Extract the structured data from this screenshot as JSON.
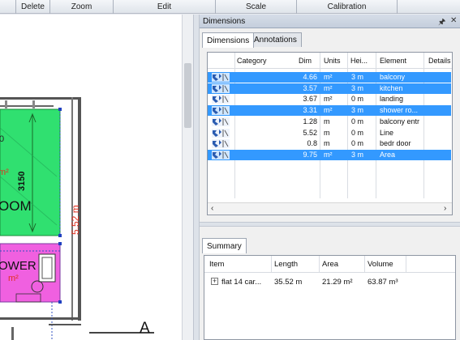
{
  "toolbar": {
    "groups": [
      "Delete",
      "Zoom",
      "Edit",
      "Scale",
      "Calibration"
    ]
  },
  "canvas": {
    "labels": {
      "zero": "0",
      "m2_partial": "m²",
      "dim_3150": "3150",
      "room_partial": "OOM",
      "dim_552": "5.52 m",
      "ower": "OWER",
      "m2_pink": "m²",
      "letter_a": "A"
    },
    "colors": {
      "green_room": "#30e070",
      "pink_room": "#f060e0",
      "red_text": "#e03020"
    }
  },
  "panel": {
    "title": "Dimensions",
    "pin_icon": "pin-icon",
    "close_icon": "close-icon",
    "tabs": [
      "Dimensions",
      "Annotations"
    ],
    "grid": {
      "columns": [
        "Category",
        "Dim",
        "Units",
        "Hei...",
        "Element",
        "Details"
      ],
      "rows": [
        {
          "dim": "4.66",
          "units": "m²",
          "height": "3 m",
          "element": "balcony",
          "selected": true
        },
        {
          "dim": "3.57",
          "units": "m²",
          "height": "3 m",
          "element": "kitchen",
          "selected": true
        },
        {
          "dim": "3.67",
          "units": "m²",
          "height": "0 m",
          "element": "landing",
          "selected": false
        },
        {
          "dim": "3.31",
          "units": "m²",
          "height": "3 m",
          "element": "shower ro...",
          "selected": true
        },
        {
          "dim": "1.28",
          "units": "m",
          "height": "0 m",
          "element": "balcony entr",
          "selected": false
        },
        {
          "dim": "5.52",
          "units": "m",
          "height": "0 m",
          "element": "Line",
          "selected": false
        },
        {
          "dim": "0.8",
          "units": "m",
          "height": "0 m",
          "element": "bedr door",
          "selected": false
        },
        {
          "dim": "9.75",
          "units": "m²",
          "height": "3 m",
          "element": "Area",
          "selected": true
        }
      ],
      "scroll_left": "‹",
      "scroll_right": "›"
    },
    "summary": {
      "tab": "Summary",
      "columns": [
        "Item",
        "Length",
        "Area",
        "Volume"
      ],
      "row": {
        "expander": "+",
        "item": "flat 14 car...",
        "length": "35.52 m",
        "area": "21.29 m²",
        "volume": "63.87 m³"
      }
    },
    "selection_color": "#3399ff"
  }
}
